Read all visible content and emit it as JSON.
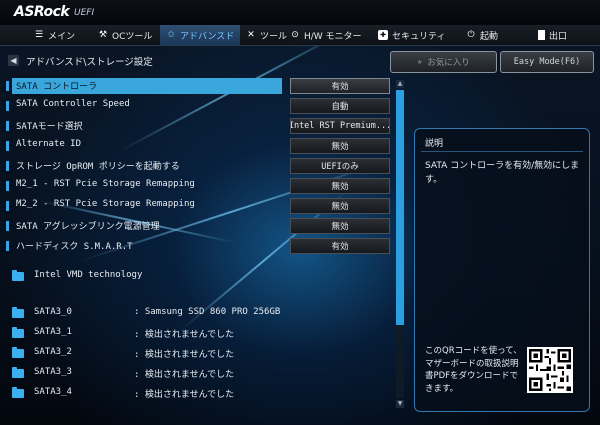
{
  "brand": {
    "logo": "ASRock",
    "sub": "UEFI"
  },
  "nav": {
    "items": [
      {
        "label": "メイン",
        "icon": "menu-icon"
      },
      {
        "label": "OCツール",
        "icon": "oc-icon"
      },
      {
        "label": "アドバンスド",
        "icon": "star-icon"
      },
      {
        "label": "ツール",
        "icon": "tool-icon"
      },
      {
        "label": "H/W モニター",
        "icon": "monitor-icon"
      },
      {
        "label": "セキュリティ",
        "icon": "shield-icon"
      },
      {
        "label": "起動",
        "icon": "power-icon"
      },
      {
        "label": "出口",
        "icon": "exit-icon"
      }
    ]
  },
  "breadcrumb": "アドバンスド\\ストレージ設定",
  "favorites_label": "お気に入り",
  "easy_mode_label": "Easy Mode(F6)",
  "settings": [
    {
      "label": "SATA コントローラ",
      "value": "有効"
    },
    {
      "label": "SATA Controller Speed",
      "value": "自動"
    },
    {
      "label": "SATAモード選択",
      "value": "Intel RST Premium..."
    },
    {
      "label": "Alternate ID",
      "value": "無効"
    },
    {
      "label": "ストレージ OpROM ポリシーを起動する",
      "value": "UEFIのみ"
    },
    {
      "label": "M2_1 - RST Pcie Storage Remapping",
      "value": "無効"
    },
    {
      "label": "M2_2 - RST Pcie Storage Remapping",
      "value": "無効"
    },
    {
      "label": "SATA アグレッシブリンク電源管理",
      "value": "無効"
    },
    {
      "label": "ハードディスク S.M.A.R.T",
      "value": "有効"
    }
  ],
  "vmd_label": "Intel VMD technology",
  "ports": [
    {
      "name": "SATA3_0",
      "value": ": Samsung SSD 860 PRO 256GB"
    },
    {
      "name": "SATA3_1",
      "value": ": 検出されませんでした"
    },
    {
      "name": "SATA3_2",
      "value": ": 検出されませんでした"
    },
    {
      "name": "SATA3_3",
      "value": ": 検出されませんでした"
    },
    {
      "name": "SATA3_4",
      "value": ": 検出されませんでした"
    }
  ],
  "description": {
    "title": "説明",
    "text": "SATA コントローラを有効/無効にします。",
    "qr_text": "このQRコードを使って、マザーボードの取扱説明書PDFをダウンロードできます。"
  },
  "colors": {
    "accent": "#3aa7dc",
    "highlight_text": "#7cc8ff"
  }
}
